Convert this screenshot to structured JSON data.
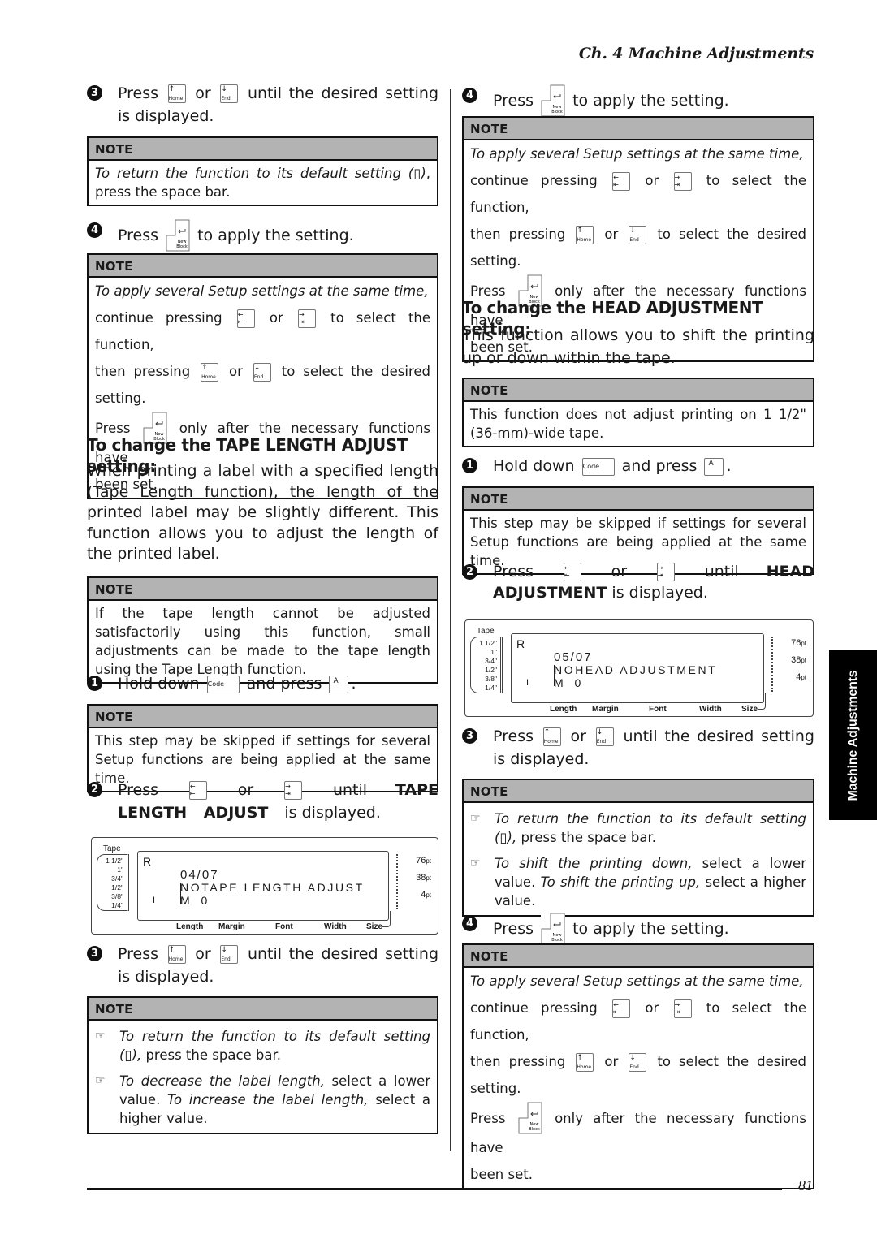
{
  "header": {
    "chapter_title": "Ch. 4 Machine Adjustments"
  },
  "side_tab": {
    "label": "Machine Adjustments"
  },
  "footer": {
    "page_number": "81"
  },
  "icons": {
    "step_bullet": "filled-circle-number",
    "note_bullet": "pointing-hand-icon",
    "keys": [
      "home-up-key",
      "end-down-key",
      "left-arrow-key",
      "right-arrow-key",
      "new-block-enter-key",
      "code-key",
      "a-key"
    ]
  },
  "common": {
    "note_label": "NOTE",
    "or": "or",
    "press": "Press",
    "key_code": "Code",
    "key_a": "A"
  },
  "left": {
    "step3_top": {
      "num": "3",
      "pre": "Press",
      "post": "until the desired setting is displayed."
    },
    "note_default": {
      "pre": "To return the function to its default setting (",
      "glyph": "▯",
      "mid": "), ",
      "post": "press the space bar."
    },
    "step4_top": {
      "num": "4",
      "pre": "Press",
      "post": "to apply the setting."
    },
    "note_apply": {
      "line1": "To apply several Setup settings at the same time,",
      "line2_pre": "continue pressing",
      "line2_post": "to select the function,",
      "line3_pre": "then pressing",
      "line3_post": "to select the desired setting.",
      "line4_pre": "Press",
      "line4_post": "only after the necessary functions have",
      "line5": "been set."
    },
    "tape_section": {
      "heading": "To change the TAPE LENGTH ADJUST setting:",
      "body": "When printing a label with a specified length (Tape Length function), the length of the printed label may be slightly different. This function allows you to adjust the length of the printed label.",
      "note1": "If the tape length cannot be adjusted satisfactorily using this function, small adjustments can be made to the tape length using the Tape Length function.",
      "step1": {
        "num": "1",
        "pre": "Hold down",
        "mid": "and press",
        "post": "."
      },
      "note2": "This step may be skipped if settings for several Setup functions are being applied at the same time.",
      "step2": {
        "num": "2",
        "pre": "Press",
        "mid": "until",
        "bold": "TAPE LENGTH ADJUST",
        "post": "is displayed."
      },
      "step3": {
        "num": "3",
        "pre": "Press",
        "post": "until the desired setting is displayed."
      },
      "note3_b1_italic": "To return the function to its default setting (▯),",
      "note3_b1_plain": "press the space bar.",
      "note3_b2_i1": "To decrease the label length,",
      "note3_b2_p1": "select a lower value.",
      "note3_b2_i2": "To increase the label length,",
      "note3_b2_p2": "select a higher value."
    },
    "lcd": {
      "tape_label": "Tape",
      "tape_sizes": [
        "1 1/2\"",
        "1\"",
        "3/4\"",
        "1/2\"",
        "3/8\"",
        "1/4\""
      ],
      "r_indicator": "R",
      "i_indicator": "I",
      "line1": "04/07",
      "line2": "NOTAPE LENGTH ADJUST",
      "line3": "M  0",
      "pt_labels": [
        "76",
        "38",
        "4"
      ],
      "pt_unit": "pt",
      "bottom_labels": [
        "Length",
        "Margin",
        "Font",
        "Width",
        "Size"
      ]
    }
  },
  "right": {
    "step4_top": {
      "num": "4",
      "pre": "Press",
      "post": "to apply the setting."
    },
    "note_apply": {
      "line1": "To apply several Setup settings at the same time,",
      "line2_pre": "continue pressing",
      "line2_post": "to select the function,",
      "line3_pre": "then pressing",
      "line3_post": "to select the desired setting.",
      "line4_pre": "Press",
      "line4_post": "only after the necessary functions have",
      "line5": "been set."
    },
    "head_section": {
      "heading": "To change the HEAD ADJUSTMENT setting:",
      "body": "This function allows you to shift the printing up or down within the tape.",
      "note1": "This function does not adjust printing on 1 1/2\" (36-mm)-wide tape.",
      "step1": {
        "num": "1",
        "pre": "Hold down",
        "mid": "and press",
        "post": "."
      },
      "note2": "This step may be skipped if settings for several Setup functions are being applied at the same time.",
      "step2": {
        "num": "2",
        "pre": "Press",
        "mid": "until",
        "bold": "HEAD ADJUSTMENT",
        "post": "is displayed."
      },
      "step3": {
        "num": "3",
        "pre": "Press",
        "post": "until the desired setting is displayed."
      },
      "note3_b1_italic": "To return the function to its default setting (▯),",
      "note3_b1_plain": "press the space bar.",
      "note3_b2_i1": "To shift the printing down,",
      "note3_b2_p1": "select a lower value.",
      "note3_b2_i2": "To shift the printing up,",
      "note3_b2_p2": "select a higher value.",
      "step4": {
        "num": "4",
        "pre": "Press",
        "post": "to apply the setting."
      }
    },
    "lcd": {
      "tape_label": "Tape",
      "tape_sizes": [
        "1 1/2\"",
        "1\"",
        "3/4\"",
        "1/2\"",
        "3/8\"",
        "1/4\""
      ],
      "r_indicator": "R",
      "i_indicator": "I",
      "line1": "05/07",
      "line2": "NOHEAD ADJUSTMENT",
      "line3": "M  0",
      "pt_labels": [
        "76",
        "38",
        "4"
      ],
      "pt_unit": "pt",
      "bottom_labels": [
        "Length",
        "Margin",
        "Font",
        "Width",
        "Size"
      ]
    }
  }
}
